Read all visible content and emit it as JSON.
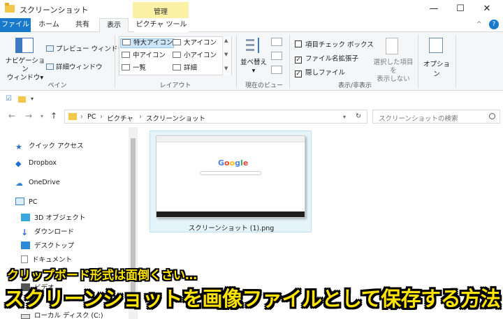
{
  "window": {
    "title": "スクリーンショット",
    "contextual_group": "管理",
    "controls": {
      "minimize": "—",
      "maximize": "☐",
      "close": "✕"
    }
  },
  "ribbon": {
    "tabs": [
      "ファイル",
      "ホーム",
      "共有",
      "表示",
      "ピクチャ ツール"
    ],
    "active_tab": "表示",
    "help": "?",
    "collapse": "^",
    "pane_group": {
      "label": "ペイン",
      "nav_pane": "ナビゲーション\nウィンドウ▾",
      "preview_pane": "プレビュー ウィンドウ",
      "details_pane": "詳細ウィンドウ"
    },
    "layout_group": {
      "label": "レイアウト",
      "items": [
        "特大アイコン",
        "大アイコン",
        "中アイコン",
        "小アイコン",
        "一覧",
        "詳細"
      ],
      "selected": "特大アイコン"
    },
    "current_view_group": {
      "label": "現在のビュー",
      "sort_by": "並べ替え\n▾"
    },
    "show_hide_group": {
      "label": "表示/非表示",
      "checkboxes": [
        {
          "label": "項目チェック ボックス",
          "checked": false
        },
        {
          "label": "ファイル名拡張子",
          "checked": true
        },
        {
          "label": "隠しファイル",
          "checked": true
        }
      ],
      "hide_selected": "選択した項目を\n表示しない"
    },
    "options": {
      "label": "オプション"
    }
  },
  "address": {
    "path": [
      "PC",
      "ピクチャ",
      "スクリーンショット"
    ],
    "search_placeholder": "スクリーンショットの検索"
  },
  "nav_pane": {
    "items": [
      {
        "label": "クイック アクセス",
        "icon": "star-icon",
        "color": "#2a6fc9"
      },
      {
        "label": "Dropbox",
        "icon": "dropbox-icon",
        "color": "#1f6fd6"
      },
      {
        "label": "OneDrive",
        "icon": "cloud-icon",
        "color": "#2f7fd8"
      },
      {
        "label": "PC",
        "icon": "pc-icon",
        "color": "#3a86d4"
      },
      {
        "label": "3D オブジェクト",
        "icon": "cube-icon",
        "color": "#3ba7e0"
      },
      {
        "label": "ダウンロード",
        "icon": "download-icon",
        "color": "#2a6fc9"
      },
      {
        "label": "デスクトップ",
        "icon": "desktop-icon",
        "color": "#2d8ad6"
      },
      {
        "label": "ドキュメント",
        "icon": "document-icon",
        "color": "#8a8a8a"
      },
      {
        "label": "ビデオ",
        "icon": "video-icon",
        "color": "#555555"
      },
      {
        "label": "ローカル ディスク (C:)",
        "icon": "disk-icon",
        "color": "#666666"
      }
    ]
  },
  "files": [
    {
      "name": "スクリーンショット (1).png",
      "thumb_logo": "Google"
    }
  ],
  "banner": {
    "subtitle": "クリップボード形式は面倒くさい…",
    "title": "スクリーンショットを画像ファイルとして保存する方法",
    "text_color": "#ffe400",
    "outline_color": "#000000"
  }
}
